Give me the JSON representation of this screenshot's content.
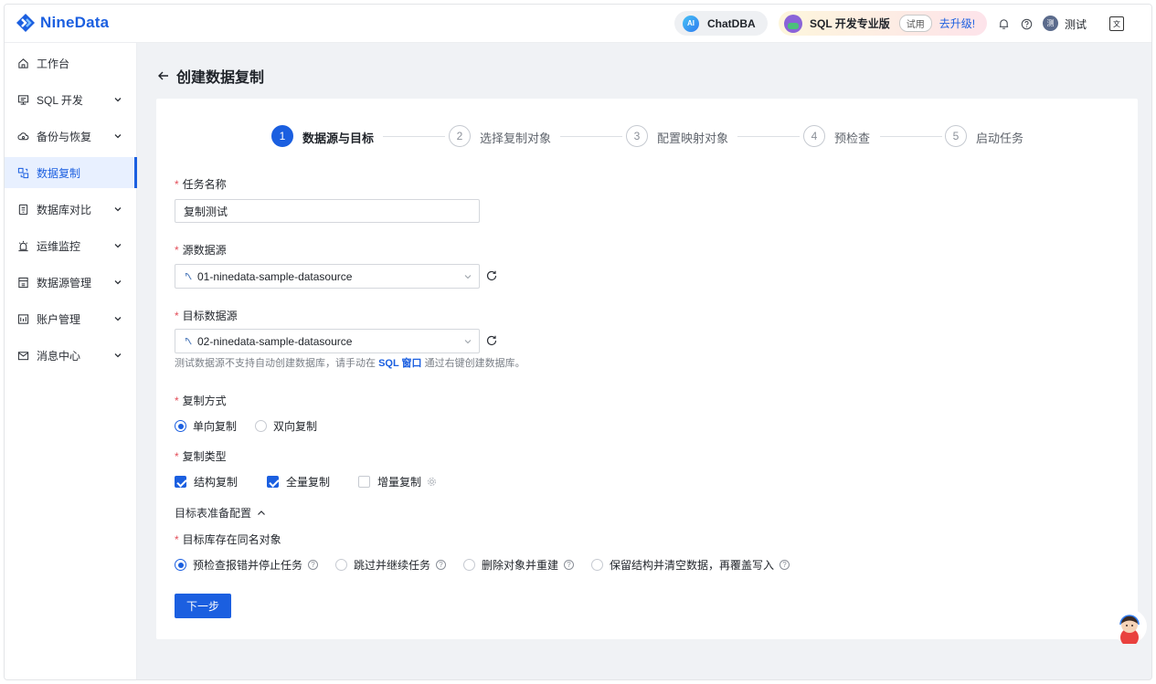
{
  "app": {
    "logo_text": "NineData",
    "chatdba_label": "ChatDBA",
    "ai_badge": "AI",
    "promo_label": "SQL 开发专业版",
    "trial_tag": "试用",
    "upgrade_label": "去升级!",
    "user_initial": "测",
    "user_name": "测试",
    "lang_icon_text": "文"
  },
  "sidebar": {
    "items": [
      {
        "label": "工作台",
        "icon": "home-icon",
        "expandable": false
      },
      {
        "label": "SQL 开发",
        "icon": "monitor-icon",
        "expandable": true
      },
      {
        "label": "备份与恢复",
        "icon": "cloud-icon",
        "expandable": true
      },
      {
        "label": "数据复制",
        "icon": "copy-icon",
        "expandable": false,
        "active": true
      },
      {
        "label": "数据库对比",
        "icon": "compare-icon",
        "expandable": true
      },
      {
        "label": "运维监控",
        "icon": "alarm-icon",
        "expandable": true
      },
      {
        "label": "数据源管理",
        "icon": "datasource-icon",
        "expandable": true
      },
      {
        "label": "账户管理",
        "icon": "account-icon",
        "expandable": true
      },
      {
        "label": "消息中心",
        "icon": "mail-icon",
        "expandable": true
      }
    ]
  },
  "page": {
    "title": "创建数据复制"
  },
  "steps": [
    {
      "num": "1",
      "label": "数据源与目标",
      "active": true
    },
    {
      "num": "2",
      "label": "选择复制对象",
      "active": false
    },
    {
      "num": "3",
      "label": "配置映射对象",
      "active": false
    },
    {
      "num": "4",
      "label": "预检查",
      "active": false
    },
    {
      "num": "5",
      "label": "启动任务",
      "active": false
    }
  ],
  "form": {
    "task_name": {
      "label": "任务名称",
      "value": "复制测试"
    },
    "source": {
      "label": "源数据源",
      "value": "01-ninedata-sample-datasource"
    },
    "target": {
      "label": "目标数据源",
      "value": "02-ninedata-sample-datasource"
    },
    "hint": {
      "before": "测试数据源不支持自动创建数据库，请手动在 ",
      "link": "SQL 窗口",
      "after": " 通过右键创建数据库。"
    },
    "mode": {
      "label": "复制方式",
      "options": [
        {
          "label": "单向复制",
          "selected": true
        },
        {
          "label": "双向复制",
          "selected": false
        }
      ]
    },
    "types": {
      "label": "复制类型",
      "options": [
        {
          "label": "结构复制",
          "checked": true
        },
        {
          "label": "全量复制",
          "checked": true
        },
        {
          "label": "增量复制",
          "checked": false
        }
      ]
    },
    "prep_toggle": "目标表准备配置",
    "conflict": {
      "label": "目标库存在同名对象",
      "options": [
        {
          "label": "预检查报错并停止任务",
          "selected": true
        },
        {
          "label": "跳过并继续任务",
          "selected": false
        },
        {
          "label": "删除对象并重建",
          "selected": false
        },
        {
          "label": "保留结构并清空数据，再覆盖写入",
          "selected": false
        }
      ]
    },
    "next_button": "下一步"
  },
  "colors": {
    "primary": "#1b5fe0",
    "required": "#e34d59",
    "page_bg": "#f0f2f5"
  }
}
